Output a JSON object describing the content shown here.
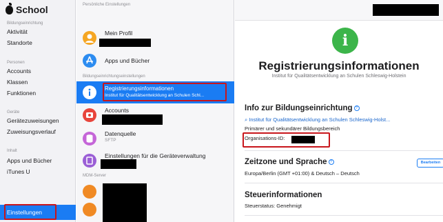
{
  "sidebar": {
    "brand": "School",
    "sections": [
      {
        "title": "Bildungseinrichtung",
        "items": [
          "Aktivität",
          "Standorte"
        ]
      },
      {
        "title": "Personen",
        "items": [
          "Accounts",
          "Klassen",
          "Funktionen"
        ]
      },
      {
        "title": "Geräte",
        "items": [
          "Gerätezuweisungen",
          "Zuweisungsverlauf"
        ]
      },
      {
        "title": "Inhalt",
        "items": [
          "Apps und Bücher",
          "iTunes U"
        ]
      }
    ],
    "selected": "Einstellungen"
  },
  "middle": {
    "group1": "Persönliche Einstellungen",
    "group2": "Bildungseinrichtungseinstellungen",
    "group3": "MDM-Server",
    "rows": [
      {
        "title": "Mein Profil",
        "subtitle": ""
      },
      {
        "title": "Apps und Bücher",
        "subtitle": ""
      },
      {
        "title": "Registrierungsinformationen",
        "subtitle": "Institut für Qualitätsentwicklung an Schulen Schl..."
      },
      {
        "title": "Accounts",
        "subtitle": ""
      },
      {
        "title": "Datenquelle",
        "subtitle": "SFTP"
      },
      {
        "title": "Einstellungen für die Geräteverwaltung",
        "subtitle": ""
      }
    ]
  },
  "detail": {
    "icon_glyph": "i",
    "title": "Registrierungsinformationen",
    "subtitle": "Institut für Qualitätsentwicklung an Schulen Schleswig-Holstein",
    "info_heading": "Info zur Bildungseinrichtung",
    "institution_link": "Institut für Qualitätsentwicklung an Schulen Schleswig-Holst...",
    "school_type": "Primärer und sekundärer Bildungsbereich",
    "org_id_label": "Organisations-ID:",
    "timezone_heading": "Zeitzone und Sprache",
    "edit_button": "Bearbeiten",
    "timezone_value": "Europa/Berlin (GMT +01:00) & Deutsch – Deutsch",
    "tax_heading": "Steuerinformationen",
    "tax_status": "Steuerstatus: Genehmigt"
  },
  "colors": {
    "accent": "#1a7cf3",
    "highlight_box": "#c8151b",
    "info_icon": "#3cb54a"
  }
}
